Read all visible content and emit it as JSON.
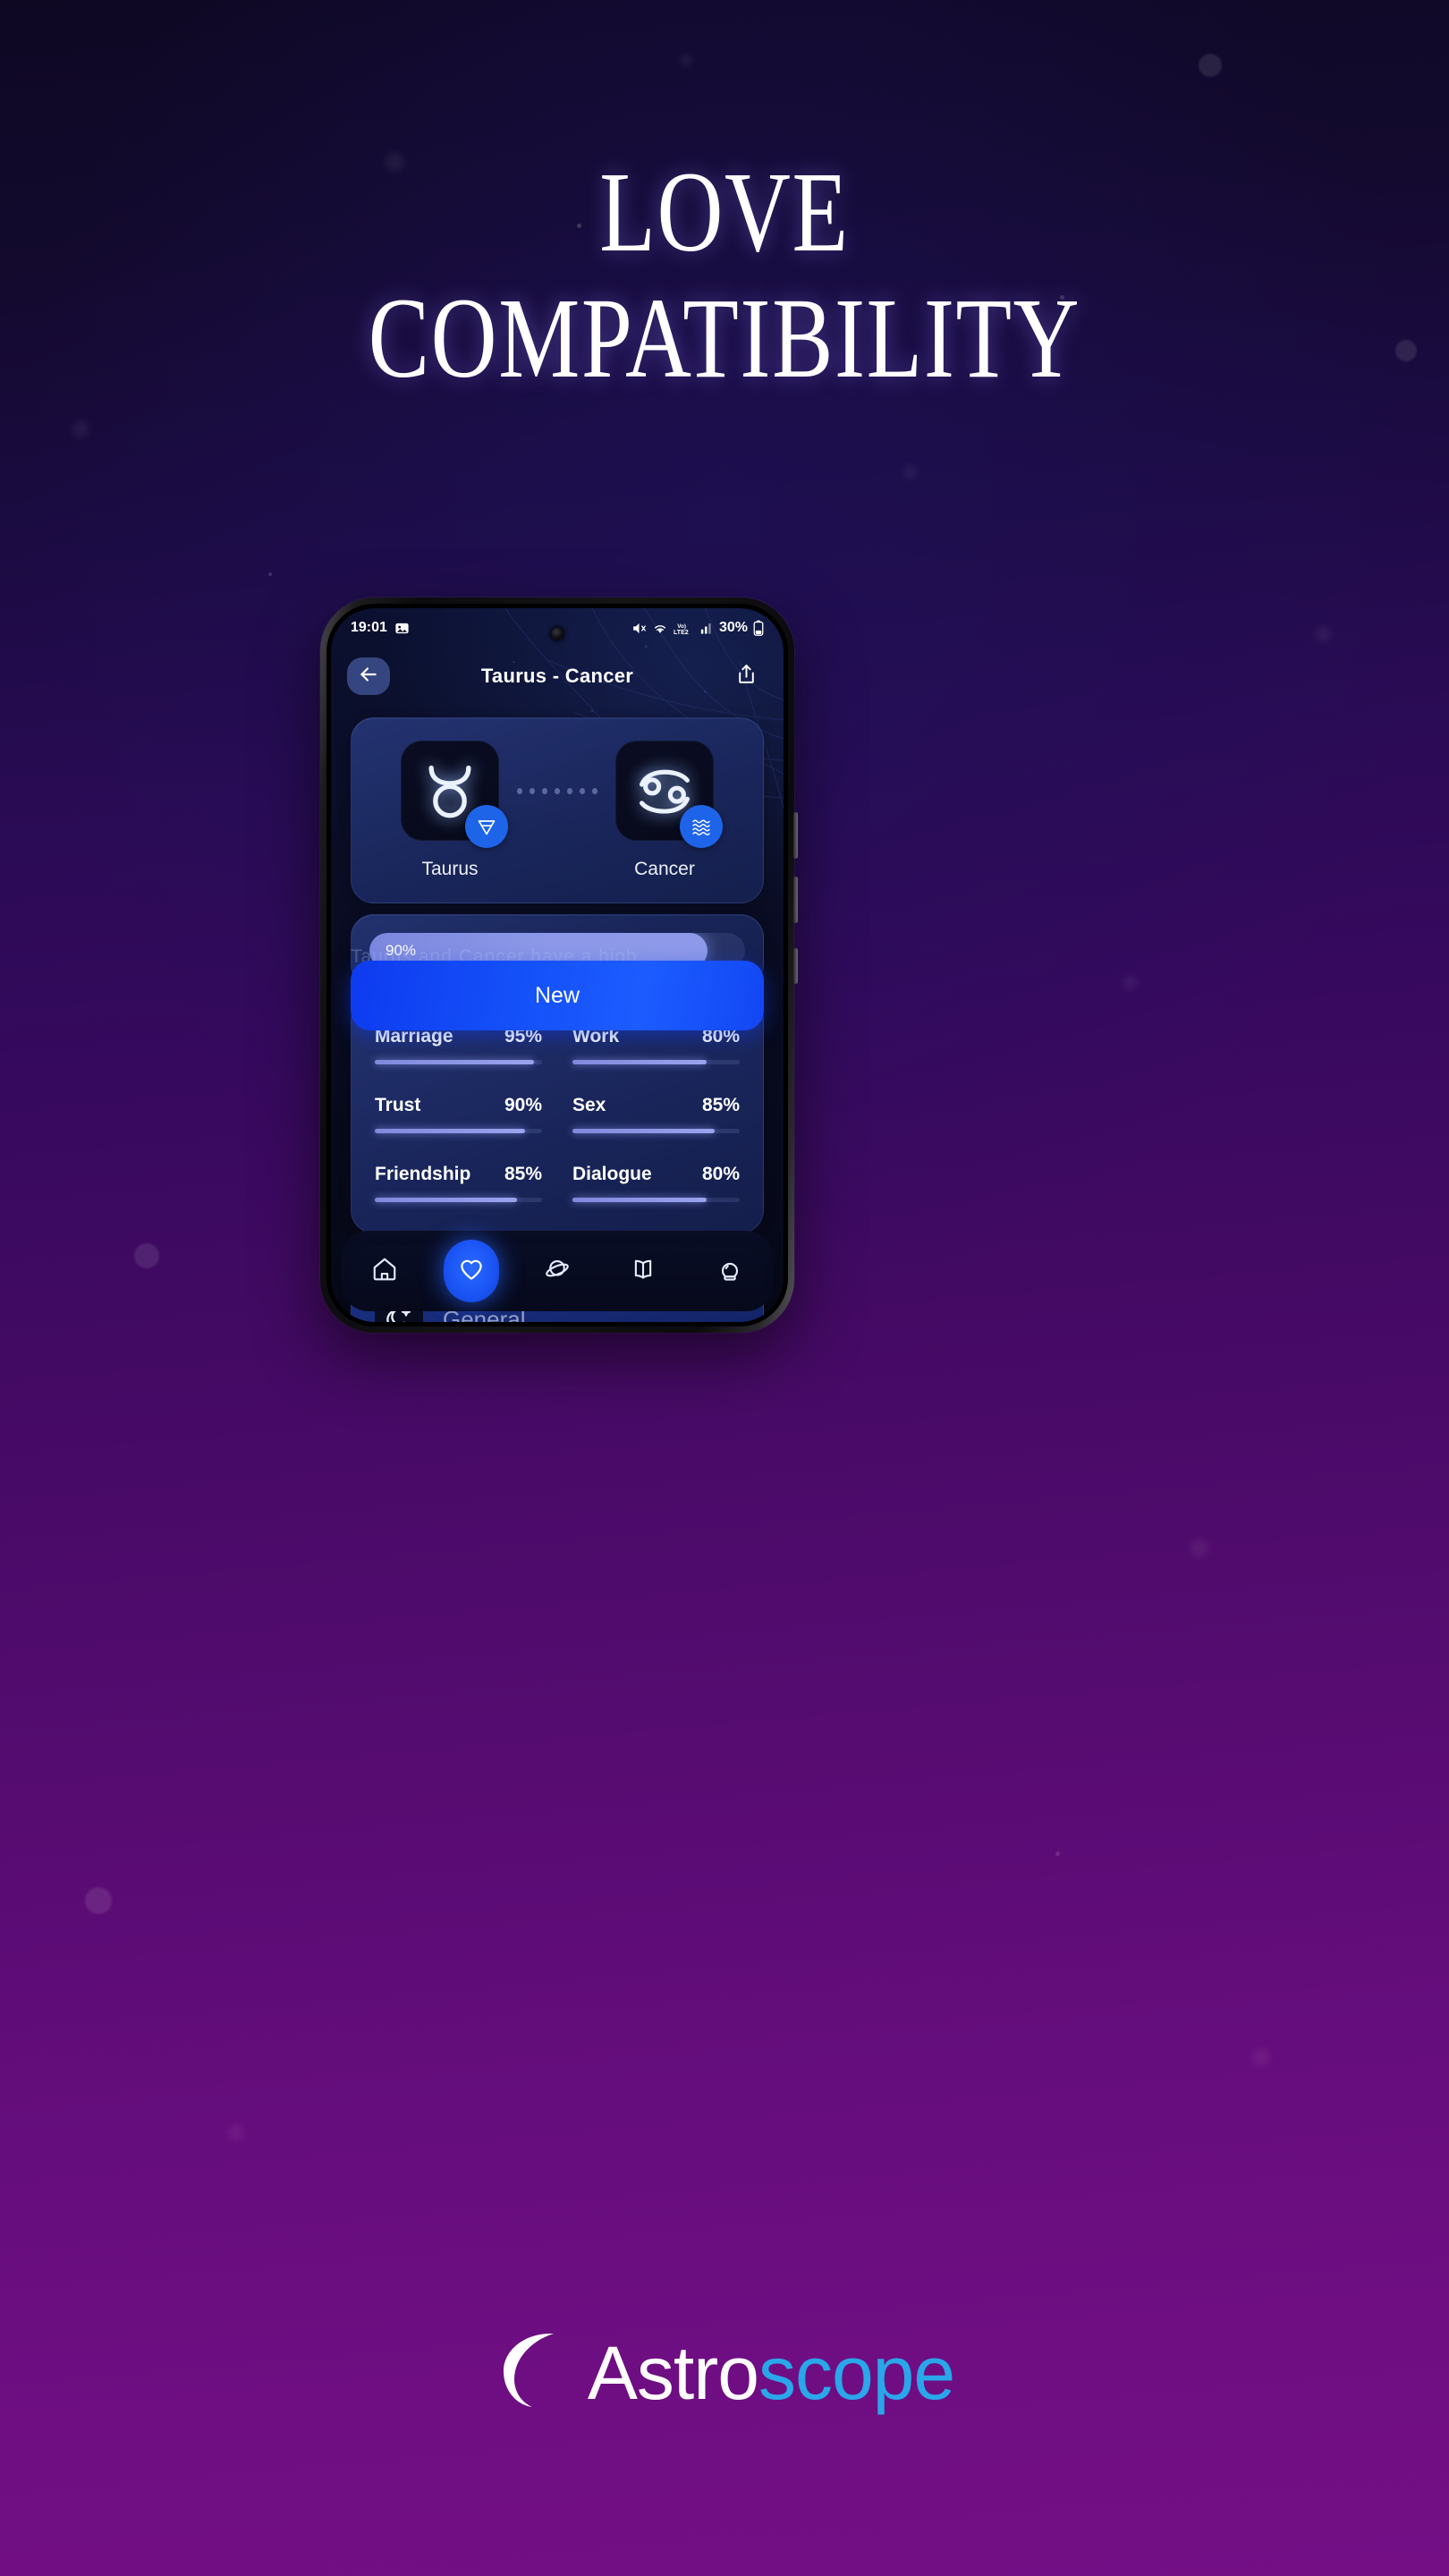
{
  "promo": {
    "headline_line1": "LOVE",
    "headline_line2": "COMPATIBILITY",
    "brand_part1": "Astro",
    "brand_part2": "scope",
    "brand_icon": "crescent-moon-icon",
    "bg_top_color": "#0E0823",
    "bg_mid_color": "#420A63",
    "bg_bottom_color": "#740F86",
    "brand_accent_color": "#2AA7EA"
  },
  "phone": {
    "status_bar": {
      "time": "19:01",
      "left_icons": [
        "screenshot-image-icon"
      ],
      "right_icons": [
        "mute-icon",
        "wifi-icon",
        "volte2-icon",
        "signal-bars-icon"
      ],
      "battery_percent": "30%",
      "battery_icon": "battery-icon"
    },
    "app_header": {
      "back_icon": "arrow-left-icon",
      "title": "Taurus - Cancer",
      "share_icon": "share-icon"
    },
    "pair": {
      "left": {
        "name": "Taurus",
        "glyph_icon": "taurus-glyph-icon",
        "element_icon": "earth-element-icon",
        "element": "earth"
      },
      "right": {
        "name": "Cancer",
        "glyph_icon": "cancer-glyph-icon",
        "element_icon": "water-element-icon",
        "element": "water"
      },
      "separator_dots": 7
    },
    "overall": {
      "label": "90%",
      "value": 90
    },
    "stats": [
      {
        "label": "Marriage",
        "value_label": "95%",
        "value": 95
      },
      {
        "label": "Work",
        "value_label": "80%",
        "value": 80
      },
      {
        "label": "Trust",
        "value_label": "90%",
        "value": 90
      },
      {
        "label": "Sex",
        "value_label": "85%",
        "value": 85
      },
      {
        "label": "Friendship",
        "value_label": "85%",
        "value": 85
      },
      {
        "label": "Dialogue",
        "value_label": "80%",
        "value": 80
      }
    ],
    "general": {
      "icon": "moon-stars-icon",
      "title": "General",
      "body": "Taurus and Cancer have a high"
    },
    "new_button": {
      "label": "New",
      "color": "#1450F8"
    },
    "bottom_nav": [
      {
        "icon": "home-icon",
        "name": "home",
        "active": false
      },
      {
        "icon": "heart-icon",
        "name": "compatibility",
        "active": true
      },
      {
        "icon": "planet-icon",
        "name": "horoscope",
        "active": false
      },
      {
        "icon": "book-icon",
        "name": "library",
        "active": false
      },
      {
        "icon": "crystal-ball-icon",
        "name": "fortune",
        "active": false
      }
    ]
  }
}
